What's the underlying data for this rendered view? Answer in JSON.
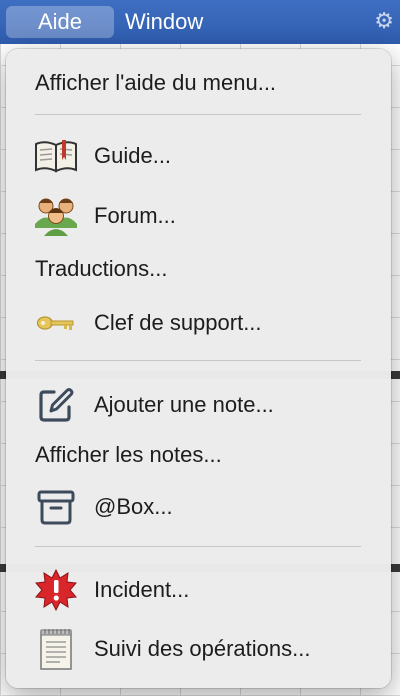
{
  "menubar": {
    "items": [
      {
        "label": "Aide",
        "active": true
      },
      {
        "label": "Window",
        "active": false
      }
    ]
  },
  "menu": {
    "items": [
      {
        "label": "Afficher l'aide du menu...",
        "icon": null
      },
      {
        "label": "Guide...",
        "icon": "book-icon"
      },
      {
        "label": "Forum...",
        "icon": "users-group-icon"
      },
      {
        "label": "Traductions...",
        "icon": null
      },
      {
        "label": "Clef de support...",
        "icon": "key-icon"
      },
      {
        "label": "Ajouter une note...",
        "icon": "edit-note-icon"
      },
      {
        "label": "Afficher les notes...",
        "icon": null
      },
      {
        "label": "@Box...",
        "icon": "archive-box-icon"
      },
      {
        "label": "Incident...",
        "icon": "alert-burst-icon"
      },
      {
        "label": "Suivi des opérations...",
        "icon": "log-notepad-icon"
      }
    ]
  },
  "colors": {
    "menubar": "#3a69bf",
    "menu_background": "#ececec",
    "text": "#1d1d1d",
    "separator": "#c7c7c7",
    "alert_red": "#d8262a",
    "user_green": "#6aa84f",
    "key_gold": "#e6c65a"
  }
}
